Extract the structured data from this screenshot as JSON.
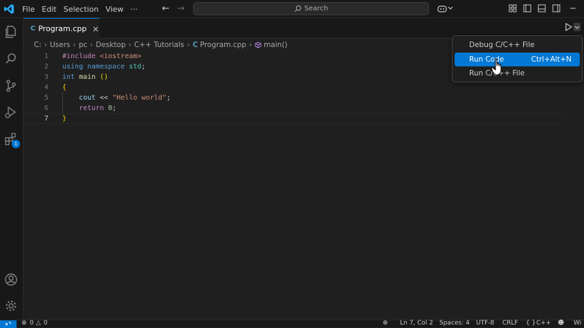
{
  "menu": [
    "File",
    "Edit",
    "Selection",
    "View",
    "···"
  ],
  "search": {
    "placeholder": "Search"
  },
  "tab": {
    "icon": "C",
    "label": "Program.cpp",
    "close": "×"
  },
  "breadcrumb": [
    "C:",
    "Users",
    "pc",
    "Desktop",
    "C++ Tutorials",
    "Program.cpp",
    "main()"
  ],
  "editor": {
    "line_numbers": [
      "1",
      "2",
      "3",
      "4",
      "5",
      "6",
      "7"
    ],
    "current_line": 7
  },
  "dropdown": {
    "items": [
      {
        "label": "Debug C/C++ File",
        "shortcut": ""
      },
      {
        "label": "Run Code",
        "shortcut": "Ctrl+Alt+N"
      },
      {
        "label": "Run C/C++ File",
        "shortcut": ""
      }
    ]
  },
  "activity": {
    "extensions_badge": "1"
  },
  "status": {
    "errors": "0",
    "warnings": "0",
    "position": "Ln 7, Col 2",
    "spaces": "Spaces: 4",
    "encoding": "UTF-8",
    "eol": "CRLF",
    "language": "C++",
    "platform": "Wi"
  },
  "colors": {
    "accent": "#0078d4",
    "background": "#1f1f1f",
    "sidebar": "#181818"
  }
}
